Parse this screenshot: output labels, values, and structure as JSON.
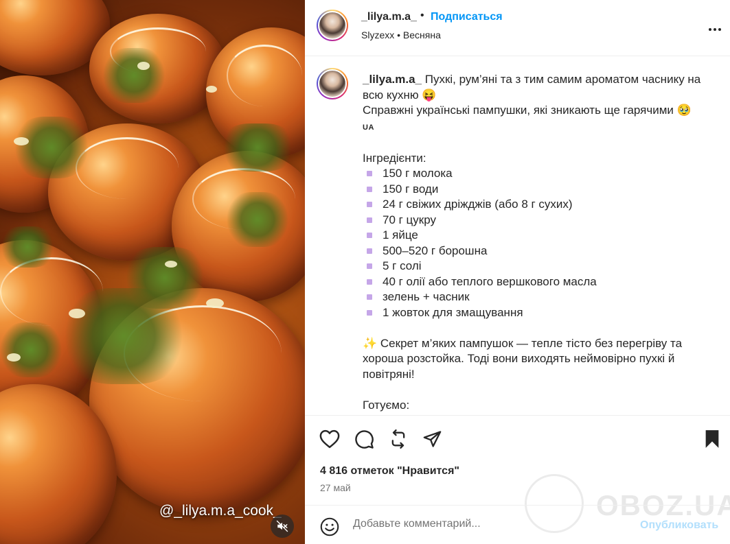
{
  "media": {
    "overlay_handle": "@_lilya.m.a_cook_",
    "mute_icon": "muted-speaker-icon"
  },
  "header": {
    "username": "_lilya.m.a_",
    "separator": "•",
    "follow_label": "Подписаться",
    "audio_artist": "Slyzexx",
    "audio_separator": "•",
    "audio_title": "Весняна",
    "more_icon": "more-options-icon"
  },
  "caption": {
    "username": "_lilya.m.a_",
    "intro_line1": " Пухкі, рум’яні та з тим самим ароматом часнику на всю кухню 😝",
    "intro_line2": "Справжні українські пампушки, які зникають ще гарячими 🥹",
    "flag": "UA",
    "ingredients_title": "Інгредієнти:",
    "ingredients": [
      "150 г молока",
      "150 г води",
      "24 г свіжих дріжджів (або 8 г сухих)",
      "70 г цукру",
      "1 яйце",
      "500–520 г борошна",
      "5 г солі",
      "40 г олії або теплого вершкового масла",
      "зелень + часник",
      "1 жовток для змащування"
    ],
    "secret_icon": "✨",
    "secret_text": " Секрет м’яких пампушок — тепле тісто без перегріву та хороша розстойка. Тоді вони виходять неймовірно пухкі й повітряні!",
    "steps_title": "Готуємо:"
  },
  "actions": {
    "like_icon": "heart-icon",
    "comment_icon": "comment-icon",
    "repost_icon": "repost-icon",
    "share_icon": "share-icon",
    "save_icon": "bookmark-icon",
    "likes_text": "4 816 отметок \"Нравится\"",
    "date_text": "27 май"
  },
  "comment": {
    "placeholder": "Добавьте комментарий...",
    "publish_label": "Опубликовать",
    "emoji_icon": "smiley-icon"
  },
  "watermark": {
    "text": "OBOZ.UA"
  },
  "colors": {
    "link_blue": "#0095f6",
    "publish_disabled": "#b2dffc",
    "bullet_purple": "#c5a6e8"
  }
}
